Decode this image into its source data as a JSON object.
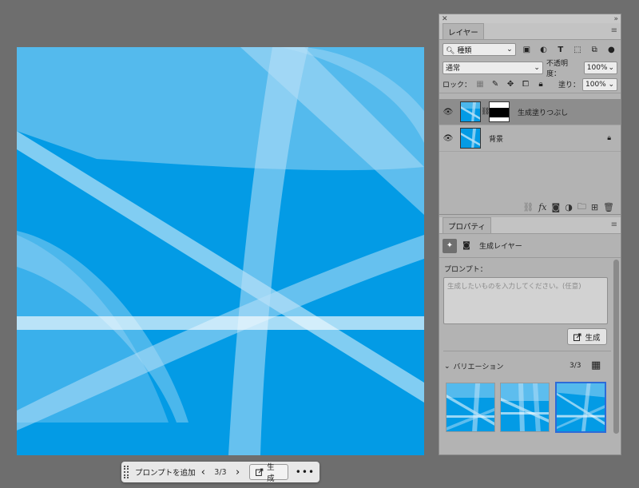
{
  "canvas": {
    "colors": {
      "base": "#039be5",
      "light": "#b8e0f7"
    }
  },
  "context_bar": {
    "add_prompt": "プロンプトを追加",
    "prev": "‹",
    "next": "›",
    "count": "3/3",
    "generate": "生成",
    "more": "•••"
  },
  "layers_panel": {
    "tab": "レイヤー",
    "filter_select": "種類",
    "blend_mode": "通常",
    "opacity_label": "不透明度：",
    "opacity_value": "100%",
    "lock_label": "ロック：",
    "fill_label": "塗り：",
    "fill_value": "100%",
    "layers": [
      {
        "name": "生成塗りつぶし",
        "selected": true
      },
      {
        "name": "背景",
        "selected": false
      }
    ]
  },
  "properties_panel": {
    "tab": "プロパティ",
    "layer_type": "生成レイヤー",
    "prompt_label": "プロンプト：",
    "prompt_placeholder": "生成したいものを入力してください。(任意)",
    "generate": "生成",
    "variations_label": "バリエーション",
    "variations_count": "3/3",
    "selected_variation": 3
  },
  "colors": {
    "panel_bg": "#b3b3b3",
    "selected_layer": "#8d8d8d",
    "accent": "#2d6bd8",
    "canvas_blue": "#039be5"
  }
}
